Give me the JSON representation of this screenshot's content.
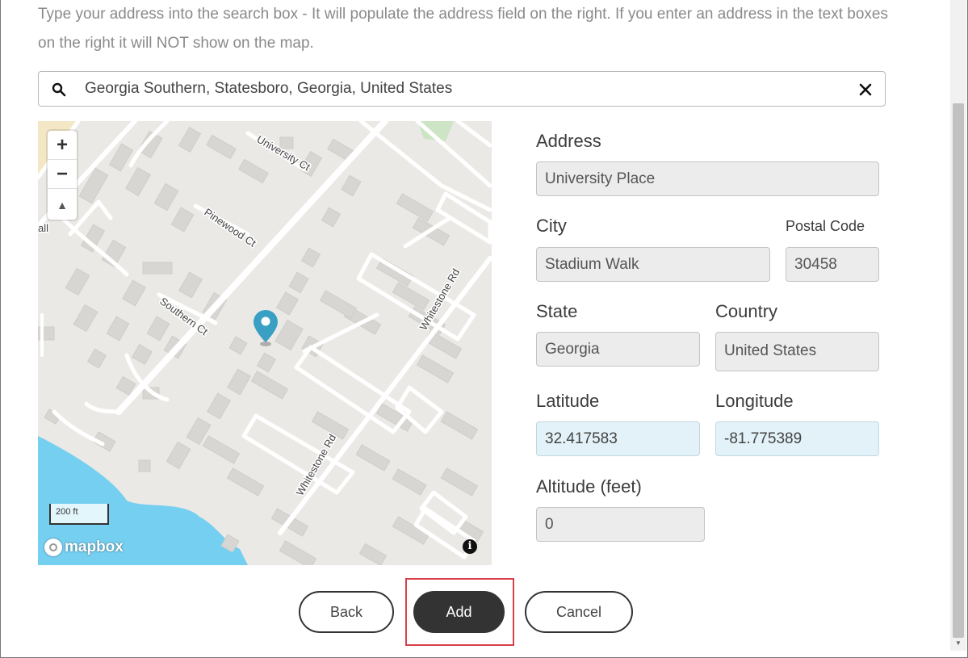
{
  "instructions": "Type your address into the search box - It will populate the address field on the right. If you enter an address in the text boxes on the right it will NOT show on the map.",
  "search": {
    "value": "Georgia Southern, Statesboro, Georgia, United States"
  },
  "map": {
    "streets": [
      "University Ct",
      "Pinewood Ct",
      "Southern Ct",
      "Whitestone Rd",
      "Whitestone Rd"
    ],
    "edge_labels": [
      "all"
    ],
    "scale_label": "200 ft",
    "logo_text": "mapbox",
    "zoom_in": "+",
    "zoom_out": "−",
    "compass": "▲",
    "info": "i",
    "water_color": "#75cff0",
    "pin_color": "#3aa0c3"
  },
  "form": {
    "address_label": "Address",
    "address_value": "University Place",
    "city_label": "City",
    "city_value": "Stadium Walk",
    "postal_label": "Postal Code",
    "postal_value": "30458",
    "state_label": "State",
    "state_value": "Georgia",
    "country_label": "Country",
    "country_value": "United States",
    "latitude_label": "Latitude",
    "latitude_value": "32.417583",
    "longitude_label": "Longitude",
    "longitude_value": "-81.775389",
    "altitude_label": "Altitude (feet)",
    "altitude_value": "0"
  },
  "buttons": {
    "back": "Back",
    "add": "Add",
    "cancel": "Cancel"
  }
}
